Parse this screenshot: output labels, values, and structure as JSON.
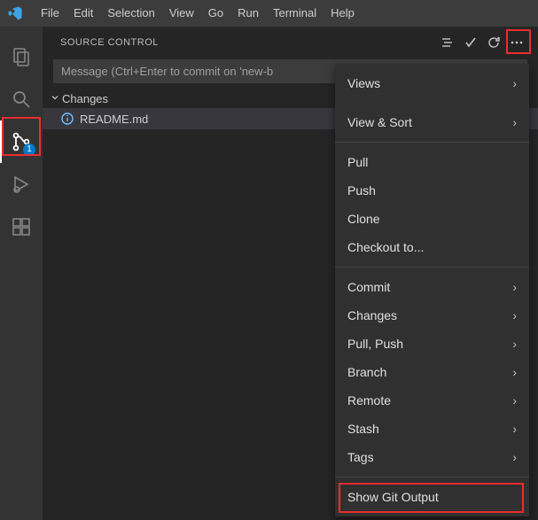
{
  "menubar": {
    "items": [
      "File",
      "Edit",
      "Selection",
      "View",
      "Go",
      "Run",
      "Terminal",
      "Help"
    ]
  },
  "activitybar": {
    "source_control_badge": "1"
  },
  "source_control": {
    "title": "SOURCE CONTROL",
    "commit_placeholder": "Message (Ctrl+Enter to commit on 'new-b",
    "changes_label": "Changes",
    "files": [
      {
        "name": "README.md"
      }
    ]
  },
  "context_menu": {
    "group1": [
      {
        "label": "Views",
        "submenu": true
      },
      {
        "label": "View & Sort",
        "submenu": true
      }
    ],
    "group2": [
      {
        "label": "Pull",
        "submenu": false
      },
      {
        "label": "Push",
        "submenu": false
      },
      {
        "label": "Clone",
        "submenu": false
      },
      {
        "label": "Checkout to...",
        "submenu": false
      }
    ],
    "group3": [
      {
        "label": "Commit",
        "submenu": true
      },
      {
        "label": "Changes",
        "submenu": true
      },
      {
        "label": "Pull, Push",
        "submenu": true
      },
      {
        "label": "Branch",
        "submenu": true
      },
      {
        "label": "Remote",
        "submenu": true
      },
      {
        "label": "Stash",
        "submenu": true
      },
      {
        "label": "Tags",
        "submenu": true
      }
    ],
    "group4": [
      {
        "label": "Show Git Output",
        "submenu": false
      }
    ]
  }
}
